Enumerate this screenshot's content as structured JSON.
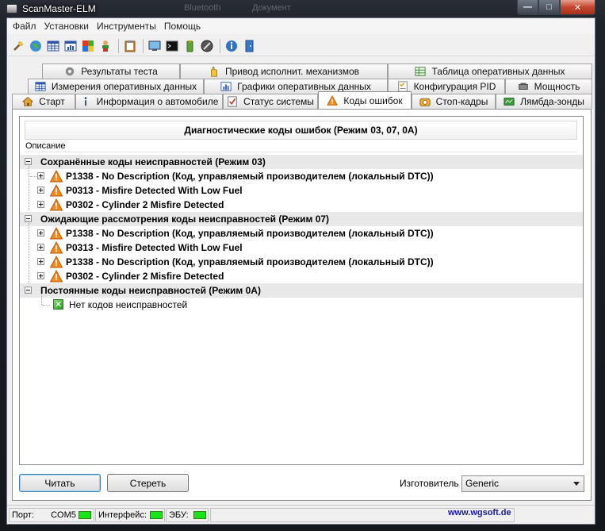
{
  "window": {
    "title": "ScanMaster-ELM",
    "ghost_titles": [
      "Bluetooth",
      "Документ"
    ]
  },
  "menu": [
    "Файл",
    "Установки",
    "Инструменты",
    "Помощь"
  ],
  "toolbar": {
    "icons": [
      "tool-icon",
      "globe-icon",
      "grid-icon",
      "chart-icon",
      "flag-icon",
      "person-icon",
      "clipboard-icon",
      "monitor-icon",
      "terminal-icon",
      "battery-icon",
      "disc-icon",
      "info-icon",
      "door-icon"
    ]
  },
  "tabs": {
    "row1": [
      "Результаты теста",
      "Привод исполнит. механизмов",
      "Таблица оперативных данных"
    ],
    "row2": [
      "Измерения оперативных данных",
      "Графики оперативных данных",
      "Конфигурация PID",
      "Мощность"
    ],
    "row3": [
      "Старт",
      "Информация о автомобиле",
      "Статус системы",
      "Коды ошибок",
      "Стоп-кадры",
      "Лямбда-зонды"
    ],
    "active": "Коды ошибок"
  },
  "dtc": {
    "header": "Диагностические коды ошибок (Режим 03, 07, 0A)",
    "column": "Описание",
    "groups": [
      {
        "title": "Сохранённые коды неисправностей (Режим 03)",
        "items": [
          "P1338 - No Description (Код, управляемый производителем (локальный DTC))",
          "P0313 - Misfire Detected With Low Fuel",
          "P0302 - Cylinder 2 Misfire Detected"
        ]
      },
      {
        "title": "Ожидающие рассмотрения коды неисправностей (Режим 07)",
        "items": [
          "P1338 - No Description (Код, управляемый производителем (локальный DTC))",
          "P0313 - Misfire Detected With Low Fuel",
          "P1338 - No Description (Код, управляемый производителем (локальный DTC))",
          "P0302 - Cylinder 2 Misfire Detected"
        ]
      },
      {
        "title": "Постоянные коды неисправностей  (Режим 0A)",
        "empty": "Нет кодов неисправностей"
      }
    ]
  },
  "buttons": {
    "read": "Читать",
    "clear": "Стереть"
  },
  "manufacturer": {
    "label": "Изготовитель",
    "value": "Generic"
  },
  "status": {
    "port_label": "Порт:",
    "port_value": "COM5",
    "interface_label": "Интерфейс:",
    "ecu_label": "ЭБУ:",
    "site": "www.wgsoft.de",
    "led_color": "#19e319"
  }
}
